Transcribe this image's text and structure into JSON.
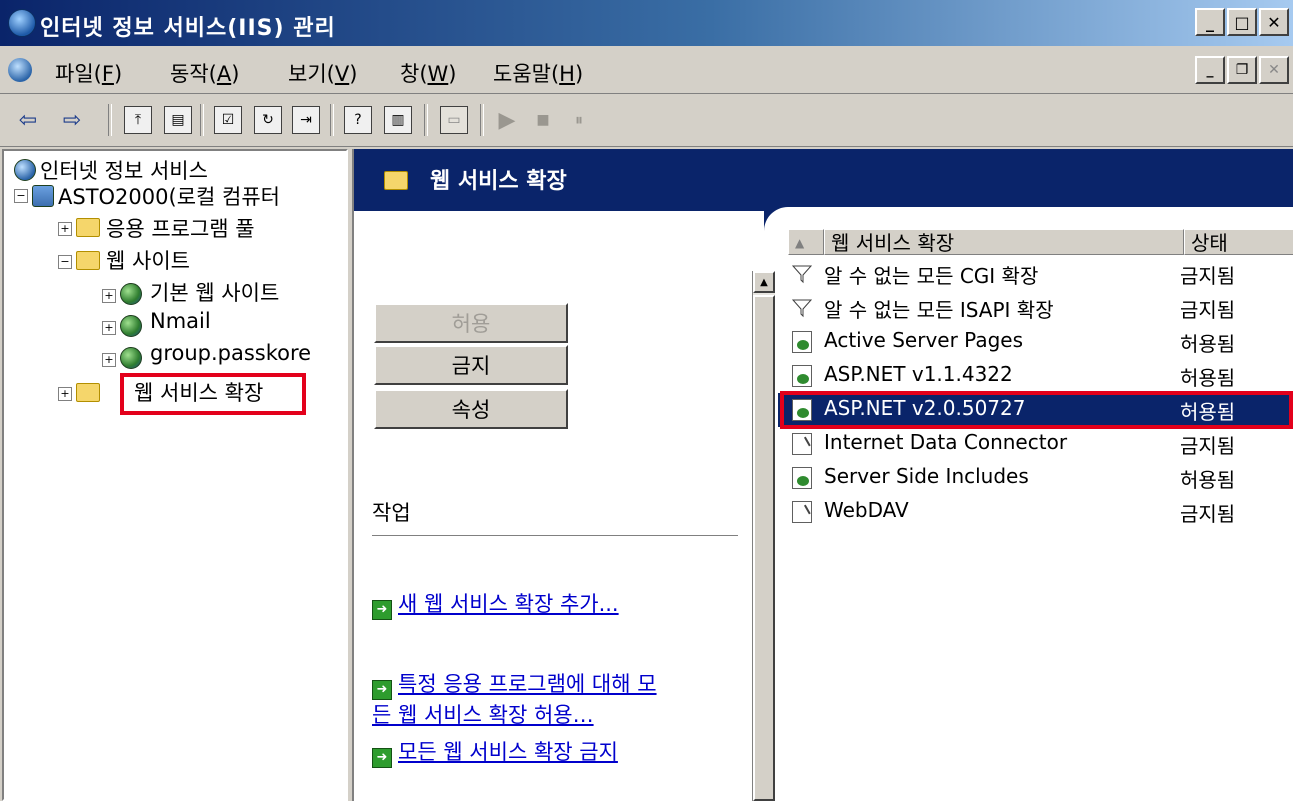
{
  "window": {
    "title": "인터넷 정보 서비스(IIS) 관리"
  },
  "menu": [
    {
      "label": "파일(",
      "key": "F",
      "suffix": ")"
    },
    {
      "label": "동작(",
      "key": "A",
      "suffix": ")"
    },
    {
      "label": "보기(",
      "key": "V",
      "suffix": ")"
    },
    {
      "label": "창(",
      "key": "W",
      "suffix": ")"
    },
    {
      "label": "도움말(",
      "key": "H",
      "suffix": ")"
    }
  ],
  "toolbar": {
    "back_glyph": "⇦",
    "forward_glyph": "⇨",
    "play_glyph": "▶",
    "stop_glyph": "■",
    "pause_glyph": "⏸"
  },
  "tree": {
    "root": "인터넷 정보 서비스",
    "server": "ASTO2000(로컬 컴퓨터",
    "app_pools": "응용 프로그램 풀",
    "websites": "웹 사이트",
    "sites": [
      "기본 웹 사이트",
      "Nmail",
      "group.passkore"
    ],
    "web_ext": "웹 서비스 확장"
  },
  "main": {
    "banner_title": "웹 서비스 확장",
    "buttons": {
      "allow": "허용",
      "prohibit": "금지",
      "properties": "속성"
    },
    "tasks_label": "작업",
    "tasks": [
      "새 웹 서비스 확장 추가...",
      "특정 응용 프로그램에 대해 모",
      "든 웹 서비스 확장 허용…",
      "모든 웹 서비스 확장 금지"
    ]
  },
  "listview": {
    "columns": {
      "name": "웹 서비스 확장",
      "status": "상태"
    },
    "rows": [
      {
        "name": "알 수 없는 모든 CGI 확장",
        "status": "금지됨",
        "icon": "filter-icon"
      },
      {
        "name": "알 수 없는 모든 ISAPI 확장",
        "status": "금지됨",
        "icon": "filter-icon"
      },
      {
        "name": "Active Server Pages",
        "status": "허용됨",
        "icon": "allowed-extension-icon"
      },
      {
        "name": "ASP.NET v1.1.4322",
        "status": "허용됨",
        "icon": "allowed-extension-icon"
      },
      {
        "name": "ASP.NET v2.0.50727",
        "status": "허용됨",
        "icon": "allowed-extension-icon"
      },
      {
        "name": "Internet Data Connector",
        "status": "금지됨",
        "icon": "prohibited-extension-icon"
      },
      {
        "name": "Server Side Includes",
        "status": "허용됨",
        "icon": "allowed-extension-icon"
      },
      {
        "name": "WebDAV",
        "status": "금지됨",
        "icon": "prohibited-extension-icon"
      }
    ],
    "selected_row": "ASP.NET v2.0.50727"
  },
  "colors": {
    "title_bar": "#0a246a",
    "selection": "#0a246a",
    "highlight_box": "#e3001b",
    "link": "#0000cc"
  }
}
